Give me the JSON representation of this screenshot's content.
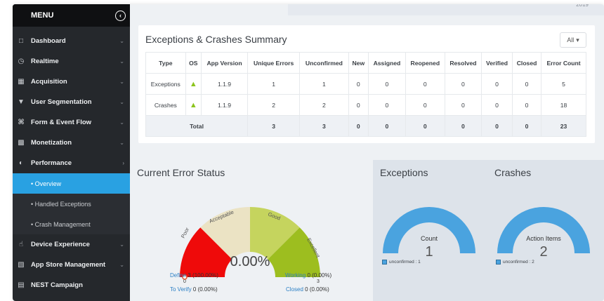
{
  "sidebar": {
    "menu_title": "MENU",
    "items": [
      {
        "label": "Dashboard",
        "icon": "monitor-icon"
      },
      {
        "label": "Realtime",
        "icon": "clock-icon"
      },
      {
        "label": "Acquisition",
        "icon": "acquisition-icon"
      },
      {
        "label": "User Segmentation",
        "icon": "filter-icon"
      },
      {
        "label": "Form & Event Flow",
        "icon": "flow-icon"
      },
      {
        "label": "Monetization",
        "icon": "monetization-icon"
      },
      {
        "label": "Performance",
        "icon": "gauge-icon"
      }
    ],
    "performance_sub": [
      "• Overview",
      "• Handled Exceptions",
      "• Crash Management"
    ],
    "items_after": [
      {
        "label": "Device Experience",
        "icon": "touch-icon"
      },
      {
        "label": "App Store Management",
        "icon": "cart-icon"
      },
      {
        "label": "NEST Campaign",
        "icon": "clipboard-icon"
      }
    ]
  },
  "top": {
    "year": "2019"
  },
  "summary": {
    "title": "Exceptions & Crashes Summary",
    "filter_label": "All",
    "columns": [
      "Type",
      "OS",
      "App Version",
      "Unique Errors",
      "Unconfirmed",
      "New",
      "Assigned",
      "Reopened",
      "Resolved",
      "Verified",
      "Closed",
      "Error Count"
    ],
    "rows": [
      [
        "Exceptions",
        "",
        "1.1.9",
        "1",
        "1",
        "0",
        "0",
        "0",
        "0",
        "0",
        "0",
        "5"
      ],
      [
        "Crashes",
        "",
        "1.1.9",
        "2",
        "2",
        "0",
        "0",
        "0",
        "0",
        "0",
        "0",
        "18"
      ]
    ],
    "total": {
      "label": "Total",
      "values": [
        "3",
        "3",
        "0",
        "0",
        "0",
        "0",
        "0",
        "0",
        "23"
      ]
    }
  },
  "error_status": {
    "title": "Current Error Status",
    "segments": [
      "Poor",
      "Acceptable",
      "Good",
      "Excellent"
    ],
    "min_tick": "0",
    "max_tick": "3",
    "value_text": "0.00%",
    "needle_fraction": 0,
    "stats": [
      {
        "label": "Define",
        "value": "3 (100.00%)"
      },
      {
        "label": "Working",
        "value": "0 (0.00%)"
      },
      {
        "label": "To Verify",
        "value": "0 (0.00%)"
      },
      {
        "label": "Closed",
        "value": "0 (0.00%)"
      }
    ],
    "colors": {
      "poor": "#ef0a0a",
      "acceptable": "#ebe3c4",
      "good": "#c5d45e",
      "excellent": "#9dbe1f",
      "needle": "#e4572e"
    }
  },
  "exceptions": {
    "title": "Exceptions",
    "gauge_label": "Count",
    "gauge_value": "1",
    "legend": "unconfirmed : 1"
  },
  "crashes": {
    "title": "Crashes",
    "gauge_label": "Action Items",
    "gauge_value": "2",
    "legend": "unconfirmed : 2"
  },
  "colors": {
    "accent": "#29a1e2",
    "donut": "#4aa3df",
    "sidebar": "#25282c"
  }
}
